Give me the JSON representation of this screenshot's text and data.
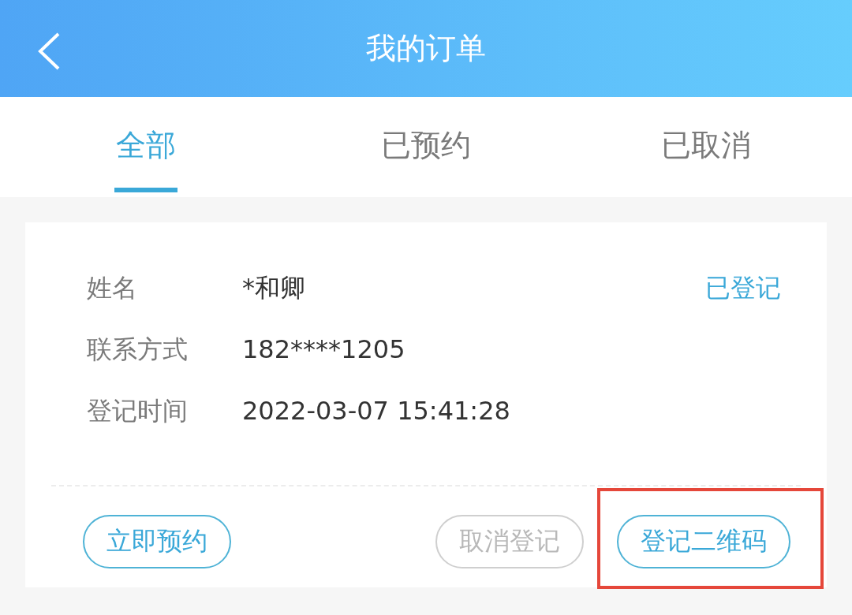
{
  "header": {
    "title": "我的订单"
  },
  "tabs": [
    {
      "label": "全部",
      "selected": true
    },
    {
      "label": "已预约",
      "selected": false
    },
    {
      "label": "已取消",
      "selected": false
    }
  ],
  "order": {
    "status": "已登记",
    "fields": [
      {
        "label": "姓名",
        "value": "*和卿"
      },
      {
        "label": "联系方式",
        "value": "182****1205"
      },
      {
        "label": "登记时间",
        "value": "2022-03-07 15:41:28"
      }
    ],
    "actions": [
      {
        "label": "立即预约",
        "disabled": false,
        "highlighted": false
      },
      {
        "label": "取消登记",
        "disabled": true,
        "highlighted": false
      },
      {
        "label": "登记二维码",
        "disabled": false,
        "highlighted": true
      }
    ]
  }
}
